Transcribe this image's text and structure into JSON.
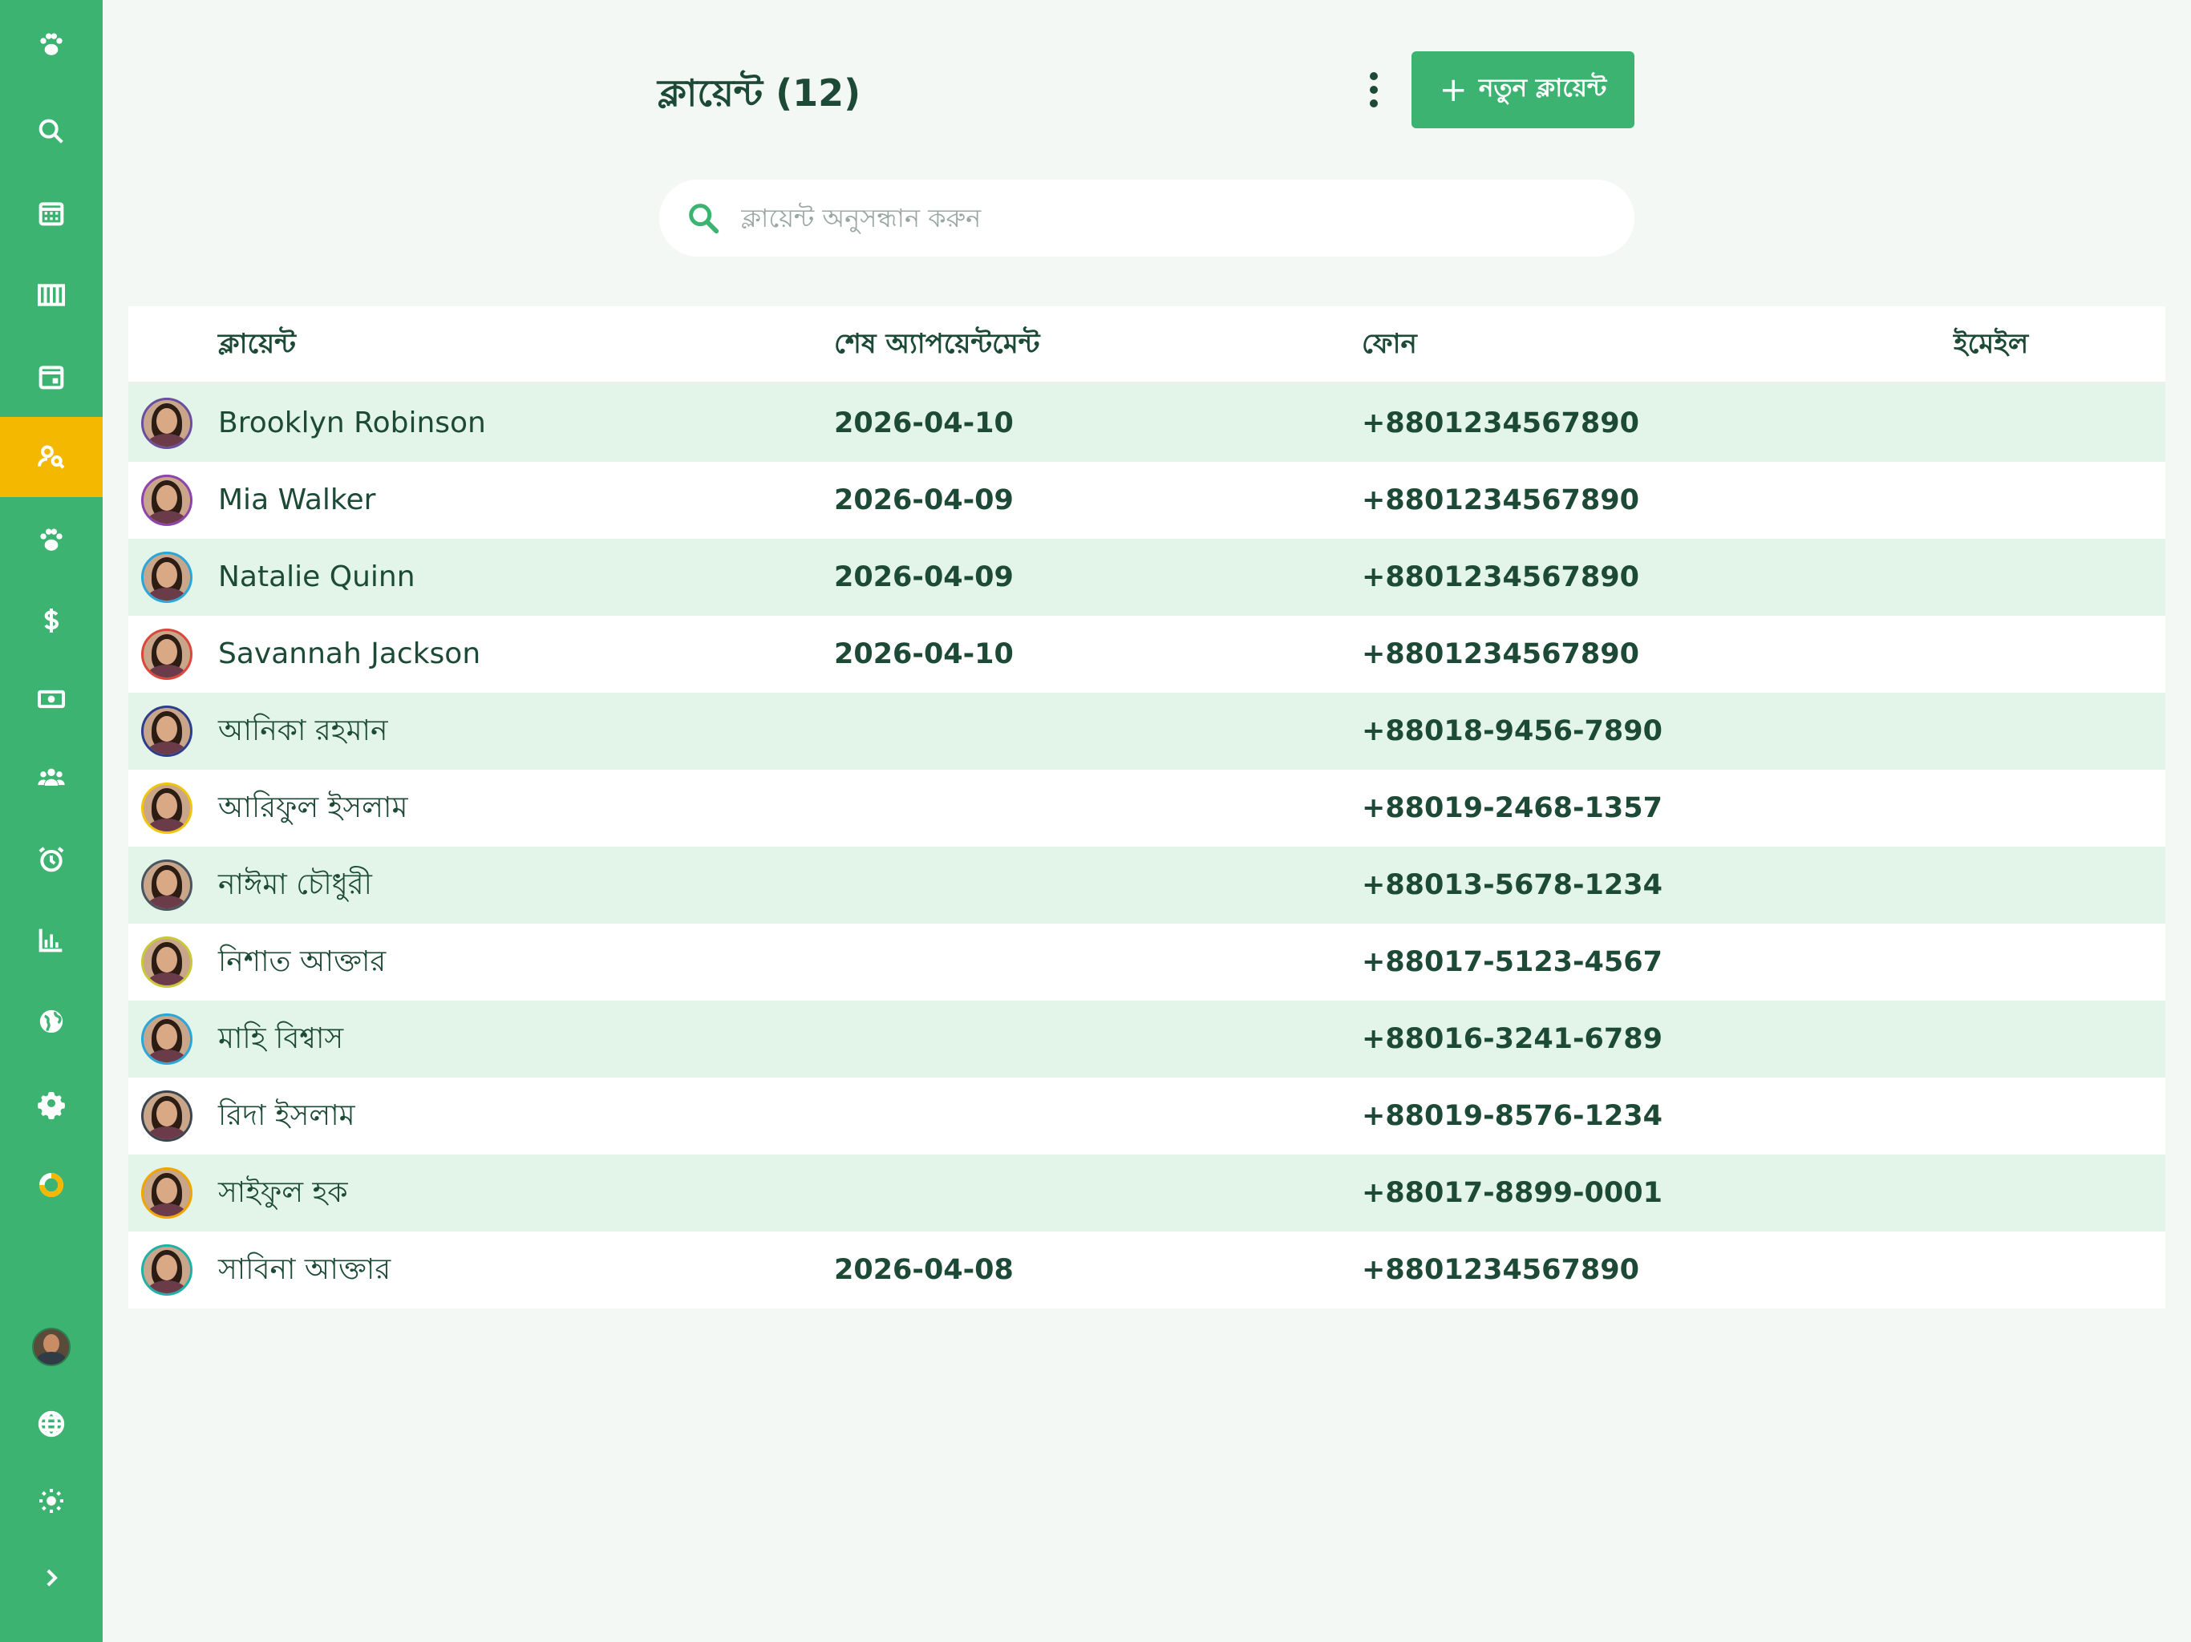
{
  "header": {
    "title": "ক্লায়েন্ট (12)",
    "new_client_label": "নতুন ক্লায়েন্ট",
    "new_client_icon": "plus-icon",
    "more_icon": "more-vertical-icon"
  },
  "search": {
    "placeholder": "ক্লায়েন্ট অনুসন্ধান করুন",
    "value": ""
  },
  "sidebar": {
    "items": [
      {
        "icon": "paw-logo-icon",
        "active": false
      },
      {
        "icon": "search-icon",
        "active": false
      },
      {
        "icon": "calendar-grid-icon",
        "active": false
      },
      {
        "icon": "columns-icon",
        "active": false
      },
      {
        "icon": "calendar-day-icon",
        "active": false
      },
      {
        "icon": "client-search-icon",
        "active": true
      },
      {
        "icon": "paw-icon",
        "active": false
      },
      {
        "icon": "dollar-icon",
        "active": false
      },
      {
        "icon": "cash-icon",
        "active": false
      },
      {
        "icon": "group-icon",
        "active": false
      },
      {
        "icon": "alarm-icon",
        "active": false
      },
      {
        "icon": "bar-chart-icon",
        "active": false
      },
      {
        "icon": "globe-filled-icon",
        "active": false
      },
      {
        "icon": "gear-icon",
        "active": false
      },
      {
        "icon": "donut-icon",
        "active": false
      }
    ],
    "bottom": [
      {
        "icon": "user-avatar"
      },
      {
        "icon": "language-globe-icon"
      },
      {
        "icon": "sun-icon"
      },
      {
        "icon": "chevron-right-icon"
      }
    ]
  },
  "table": {
    "columns": [
      "ক্লায়েন্ট",
      "শেষ অ্যাপয়েন্টমেন্ট",
      "ফোন",
      "ইমেইল"
    ],
    "rows": [
      {
        "name": "Brooklyn Robinson",
        "last": "2026-04-10",
        "phone": "+8801234567890",
        "email": "",
        "ring": "#6a4fa0"
      },
      {
        "name": "Mia Walker",
        "last": "2026-04-09",
        "phone": "+8801234567890",
        "email": "",
        "ring": "#8e44ad"
      },
      {
        "name": "Natalie Quinn",
        "last": "2026-04-09",
        "phone": "+8801234567890",
        "email": "",
        "ring": "#2aa6d8"
      },
      {
        "name": "Savannah Jackson",
        "last": "2026-04-10",
        "phone": "+8801234567890",
        "email": "",
        "ring": "#d9483b"
      },
      {
        "name": "আনিকা রহমান",
        "last": "",
        "phone": "+88018-9456-7890",
        "email": "",
        "ring": "#2c3e8c"
      },
      {
        "name": "আরিফুল ইসলাম",
        "last": "",
        "phone": "+88019-2468-1357",
        "email": "",
        "ring": "#f1c40f"
      },
      {
        "name": "নাঈমা চৌধুরী",
        "last": "",
        "phone": "+88013-5678-1234",
        "email": "",
        "ring": "#4a5560"
      },
      {
        "name": "নিশাত আক্তার",
        "last": "",
        "phone": "+88017-5123-4567",
        "email": "",
        "ring": "#c8c83a"
      },
      {
        "name": "মাহি বিশ্বাস",
        "last": "",
        "phone": "+88016-3241-6789",
        "email": "",
        "ring": "#2aa6d8"
      },
      {
        "name": "রিদা ইসলাম",
        "last": "",
        "phone": "+88019-8576-1234",
        "email": "",
        "ring": "#3b4650"
      },
      {
        "name": "সাইফুল হক",
        "last": "",
        "phone": "+88017-8899-0001",
        "email": "",
        "ring": "#f0a500"
      },
      {
        "name": "সাবিনা আক্তার",
        "last": "2026-04-08",
        "phone": "+8801234567890",
        "email": "",
        "ring": "#1fb0a8"
      }
    ]
  },
  "colors": {
    "primary": "#3cb371",
    "active": "#f5b800",
    "text": "#1d4a36",
    "row_alt": "#e3f5e9",
    "background": "#f3f8f4"
  }
}
